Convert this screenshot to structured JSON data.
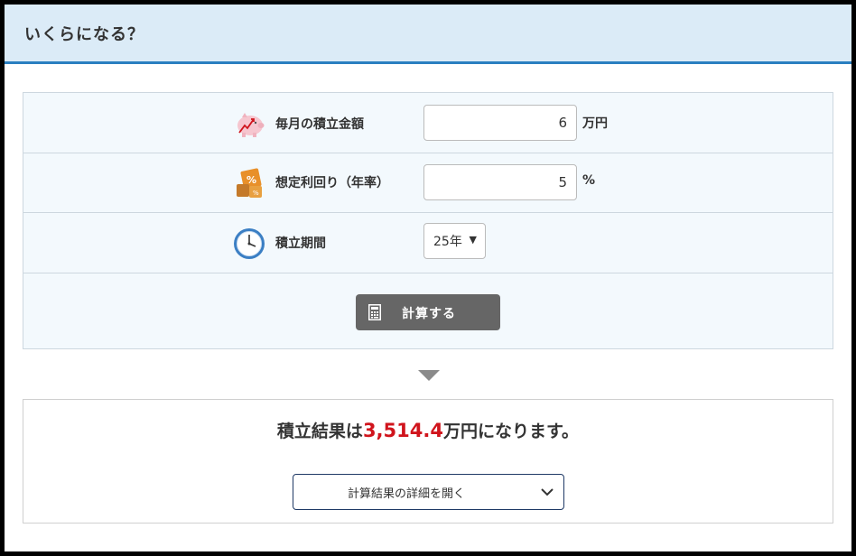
{
  "header": {
    "title": "いくらになる？"
  },
  "form": {
    "monthly": {
      "label": "毎月の積立金額",
      "value": "6",
      "unit": "万円",
      "icon": "piggy-bank-icon"
    },
    "rate": {
      "label": "想定利回り（年率）",
      "value": "5",
      "unit": "%",
      "icon": "percent-blocks-icon"
    },
    "period": {
      "label": "積立期間",
      "value": "25年",
      "icon": "clock-icon"
    },
    "calc_button": {
      "label": "計算する",
      "icon": "calculator-icon"
    }
  },
  "result": {
    "prefix": "積立結果は",
    "value": "3,514.4",
    "suffix": "万円になります。",
    "detail_button": "計算結果の詳細を開く"
  },
  "colors": {
    "header_bg": "#dbebf7",
    "header_border": "#2a7fc0",
    "button_bg": "#666666",
    "result_value": "#d0141c"
  }
}
